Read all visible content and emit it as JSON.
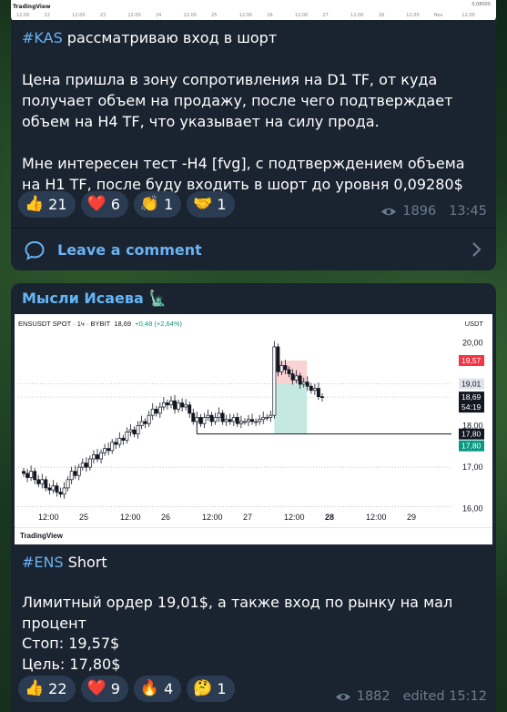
{
  "top_strip": {
    "logo": "TradingView",
    "price_label": "0,08000",
    "axis_ticks": [
      "12:00",
      "22",
      "12:00",
      "23",
      "12:00",
      "24",
      "12:00",
      "25",
      "12:00",
      "26",
      "12:00",
      "27",
      "12:00",
      "28",
      "12:00",
      "Nov",
      "12:00"
    ]
  },
  "post1": {
    "hashtag": "#KAS",
    "title_rest": " рассматриваю вход в шорт",
    "paragraph1": "Цена пришла в зону сопротивления на D1 TF, от куда получает объем на продажу, после чего подтверждает объем на H4 TF, что указывает на силу прода.",
    "paragraph2": "Мне интересен тест -H4 [fvg], с подтверждением объема на H1 TF, после буду входить в шорт до уровня  0,09280$",
    "reactions": [
      {
        "emoji": "👍",
        "count": "21"
      },
      {
        "emoji": "❤️",
        "count": "6"
      },
      {
        "emoji": "👏",
        "count": "1"
      },
      {
        "emoji": "🤝",
        "count": "1"
      }
    ],
    "views": "1896",
    "time": "13:45",
    "comment_label": "Leave a comment"
  },
  "post2": {
    "author": "Мысли Исаева 🗽",
    "hashtag": "#ENS",
    "title_rest": " Short",
    "line1": "Лимитный ордер 19,01$, а также вход по рынку на мал процент",
    "stop": "Стоп: 19,57$",
    "target": "Цель: 17,80$",
    "reactions": [
      {
        "emoji": "👍",
        "count": "22"
      },
      {
        "emoji": "❤️",
        "count": "9"
      },
      {
        "emoji": "🔥",
        "count": "4"
      },
      {
        "emoji": "🤔",
        "count": "1"
      }
    ],
    "views": "1882",
    "edited": "edited 15:12"
  },
  "chart_data": {
    "type": "candlestick",
    "symbol_line": "ENSUSDT SPOT · 1ч · BYBIT",
    "last_price": "18,69",
    "change": "+0,48 (+2,64%)",
    "currency": "USDT",
    "y_ticks": [
      "20,00",
      "19,00",
      "18,00",
      "17,00",
      "16,00"
    ],
    "x_ticks": [
      "12:00",
      "25",
      "12:00",
      "26",
      "12:00",
      "27",
      "12:00",
      "28",
      "12:00",
      "29"
    ],
    "price_tags": [
      {
        "label": "19,57",
        "color": "#f23645",
        "value": 19.57
      },
      {
        "label": "19,01",
        "color": "#787b86",
        "value": 19.01
      },
      {
        "label": "18,69",
        "color": "#131722",
        "value": 18.69
      },
      {
        "label": "54:19",
        "color": "#131722",
        "value": 18.48
      },
      {
        "label": "17,80",
        "color": "#131722",
        "value": 17.8
      },
      {
        "label": "17,80",
        "color": "#089981",
        "value": 17.8
      }
    ],
    "ylim": [
      15.95,
      20.25
    ],
    "closes": [
      16.85,
      16.75,
      16.9,
      16.7,
      16.6,
      16.7,
      16.5,
      16.45,
      16.55,
      16.4,
      16.35,
      16.5,
      16.7,
      16.9,
      16.8,
      17.0,
      17.1,
      17.0,
      17.2,
      17.3,
      17.2,
      17.35,
      17.45,
      17.4,
      17.6,
      17.55,
      17.7,
      17.65,
      17.85,
      17.9,
      17.8,
      18.0,
      18.1,
      18.05,
      18.25,
      18.4,
      18.3,
      18.45,
      18.55,
      18.5,
      18.6,
      18.4,
      18.55,
      18.45,
      18.5,
      18.3,
      18.1,
      18.2,
      18.05,
      18.2,
      18.25,
      18.1,
      18.2,
      18.3,
      18.1,
      18.15,
      18.1,
      18.2,
      18.05,
      18.1,
      18.1,
      18.15,
      18.1,
      18.1,
      18.15,
      18.2,
      18.2,
      18.25,
      19.9,
      19.3,
      19.45,
      19.35,
      19.25,
      19.1,
      19.2,
      19.0,
      19.05,
      18.95,
      18.85,
      18.9,
      18.7,
      18.69
    ],
    "position": {
      "entry": 19.01,
      "stop": 19.57,
      "target": 17.8,
      "stop_line": 17.8
    },
    "watermark": "TradingView"
  }
}
